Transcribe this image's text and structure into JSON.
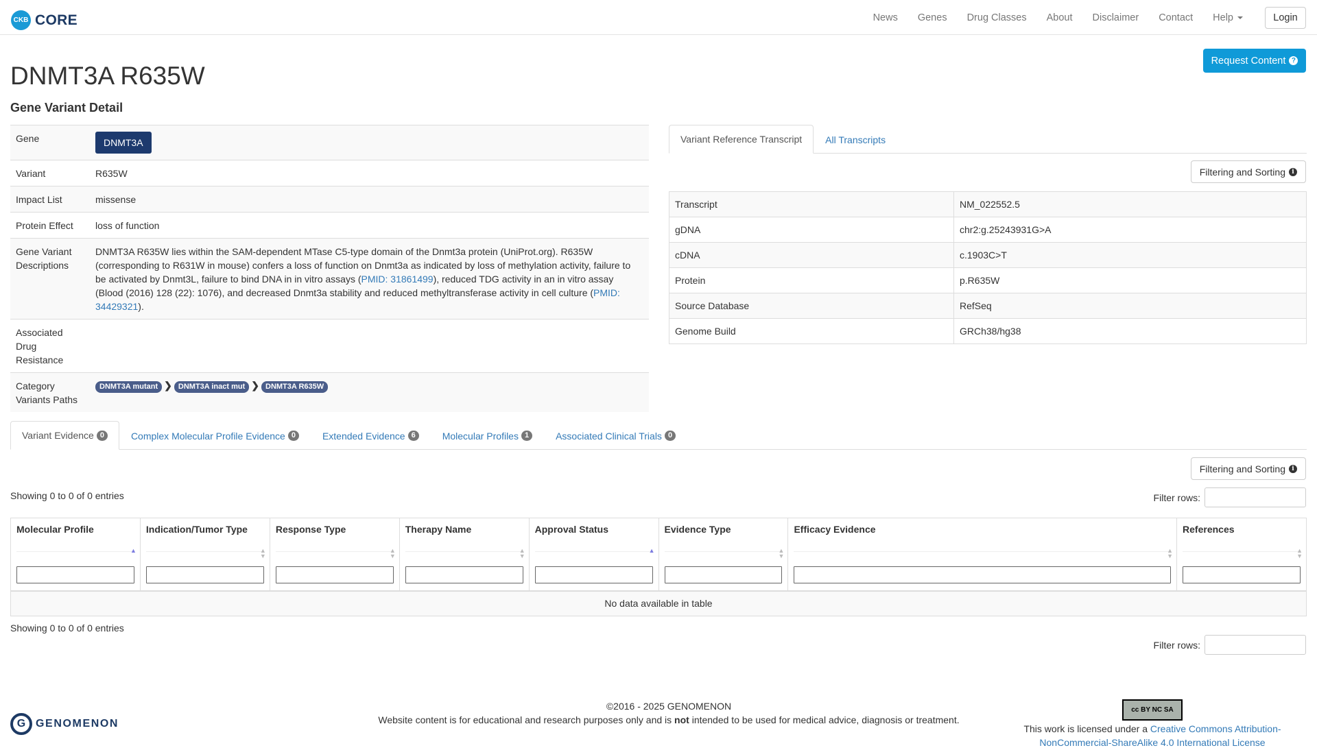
{
  "navbar": {
    "logo_badge": "CKB",
    "brand": "CORE",
    "links": [
      "News",
      "Genes",
      "Drug Classes",
      "About",
      "Disclaimer",
      "Contact",
      "Help"
    ],
    "login": "Login"
  },
  "header": {
    "title": "DNMT3A R635W",
    "subtitle": "Gene Variant Detail",
    "request_button": "Request Content"
  },
  "detail": {
    "gene_label": "Gene",
    "gene_value": "DNMT3A",
    "variant_label": "Variant",
    "variant_value": "R635W",
    "impact_label": "Impact List",
    "impact_value": "missense",
    "protein_effect_label": "Protein Effect",
    "protein_effect_value": "loss of function",
    "descriptions_label": "Gene Variant Descriptions",
    "description_part1": "DNMT3A R635W lies within the SAM-dependent MTase C5-type domain of the Dnmt3a protein (UniProt.org). R635W (corresponding to R631W in mouse) confers a loss of function on Dnmt3a as indicated by loss of methylation activity, failure to be activated by Dnmt3L, failure to bind DNA in in vitro assays (",
    "pmid1": "PMID: 31861499",
    "description_part2": "), reduced TDG activity in an in vitro assay (Blood (2016) 128 (22): 1076), and decreased Dnmt3a stability and reduced methyltransferase activity in cell culture (",
    "pmid2": "PMID: 34429321",
    "description_part3": ").",
    "resistance_label": "Associated Drug Resistance",
    "resistance_value": "",
    "category_label": "Category Variants Paths",
    "category_paths": [
      "DNMT3A mutant",
      "DNMT3A inact mut",
      "DNMT3A R635W"
    ]
  },
  "transcript_panel": {
    "tabs": [
      "Variant Reference Transcript",
      "All Transcripts"
    ],
    "filter_button": "Filtering and Sorting",
    "rows": [
      {
        "label": "Transcript",
        "value": "NM_022552.5"
      },
      {
        "label": "gDNA",
        "value": "chr2:g.25243931G>A"
      },
      {
        "label": "cDNA",
        "value": "c.1903C>T"
      },
      {
        "label": "Protein",
        "value": "p.R635W"
      },
      {
        "label": "Source Database",
        "value": "RefSeq"
      },
      {
        "label": "Genome Build",
        "value": "GRCh38/hg38"
      }
    ]
  },
  "evidence_tabs": [
    {
      "label": "Variant Evidence",
      "count": "0"
    },
    {
      "label": "Complex Molecular Profile Evidence",
      "count": "0"
    },
    {
      "label": "Extended Evidence",
      "count": "6"
    },
    {
      "label": "Molecular Profiles",
      "count": "1"
    },
    {
      "label": "Associated Clinical Trials",
      "count": "0"
    }
  ],
  "evidence_table": {
    "filter_button": "Filtering and Sorting",
    "showing_top": "Showing 0 to 0 of 0 entries",
    "showing_bottom": "Showing 0 to 0 of 0 entries",
    "filter_rows_label": "Filter rows:",
    "columns": [
      "Molecular Profile",
      "Indication/Tumor Type",
      "Response Type",
      "Therapy Name",
      "Approval Status",
      "Evidence Type",
      "Efficacy Evidence",
      "References"
    ],
    "empty_message": "No data available in table"
  },
  "footer": {
    "logo_text": "GENOMENON",
    "copyright": "©2016 - 2025 GENOMENON",
    "disclaimer_part1": "Website content is for educational and research purposes only and is ",
    "disclaimer_bold": "not",
    "disclaimer_part2": " intended to be used for medical advice, diagnosis or treatment.",
    "license_prefix": "This work is licensed under a ",
    "license_link": "Creative Commons Attribution-NonCommercial-ShareAlike 4.0 International License",
    "cc_badge": "cc BY NC SA"
  }
}
